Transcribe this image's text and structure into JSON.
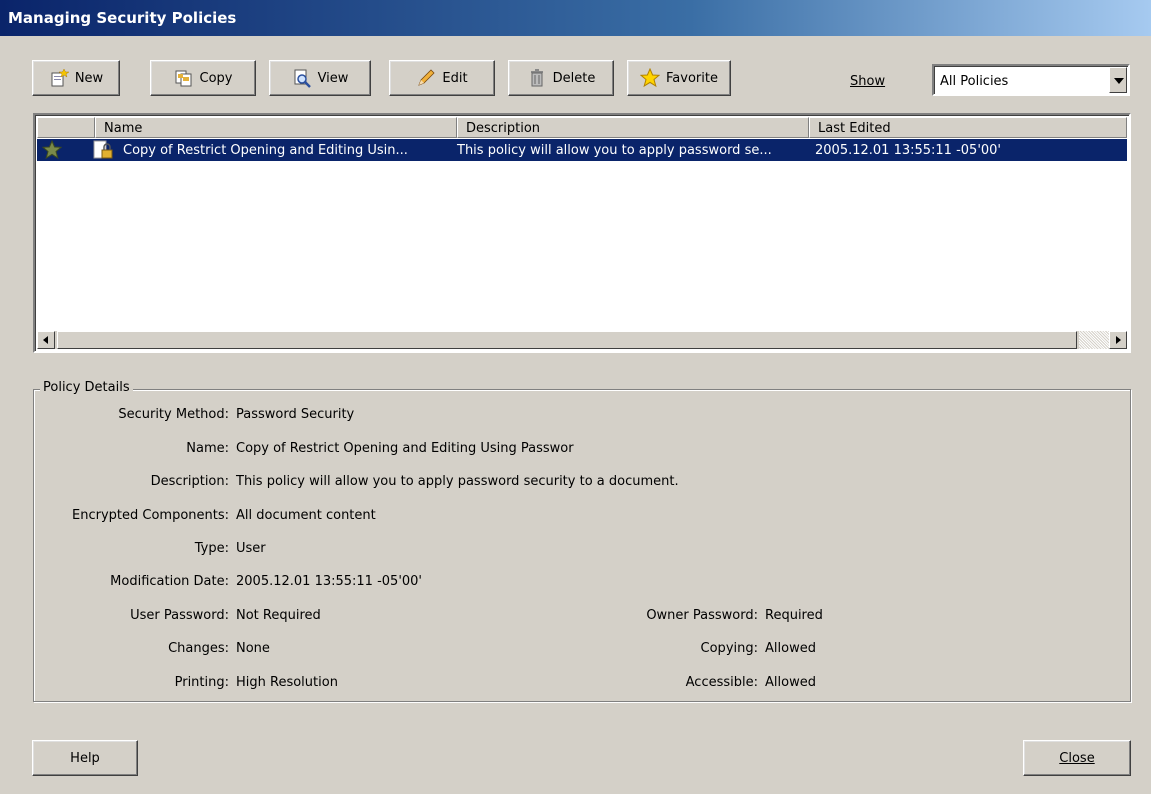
{
  "window": {
    "title": "Managing Security Policies"
  },
  "toolbar": {
    "new_label": "New",
    "copy_label": "Copy",
    "view_label": "View",
    "edit_label": "Edit",
    "delete_label": "Delete",
    "favorite_label": "Favorite",
    "show_label": "Show",
    "show_selected": "All Policies"
  },
  "list": {
    "columns": {
      "name": "Name",
      "description": "Description",
      "last_edited": "Last Edited"
    },
    "rows": [
      {
        "favorite": true,
        "name": "Copy of Restrict Opening and Editing Usin...",
        "description": "This policy will allow you to apply password se...",
        "last_edited": "2005.12.01 13:55:11 -05'00'"
      }
    ]
  },
  "details": {
    "legend": "Policy Details",
    "security_method_label": "Security Method:",
    "security_method": "Password Security",
    "name_label": "Name:",
    "name": "Copy of Restrict Opening and Editing Using Passwor",
    "description_label": "Description:",
    "description": "This policy will allow you to apply password security to a document.",
    "encrypted_label": "Encrypted Components:",
    "encrypted": "All document content",
    "type_label": "Type:",
    "type": "User",
    "modification_label": "Modification Date:",
    "modification": "2005.12.01 13:55:11 -05'00'",
    "user_password_label": "User Password:",
    "user_password": "Not Required",
    "owner_password_label": "Owner Password:",
    "owner_password": "Required",
    "changes_label": "Changes:",
    "changes": "None",
    "copying_label": "Copying:",
    "copying": "Allowed",
    "printing_label": "Printing:",
    "printing": "High Resolution",
    "accessible_label": "Accessible:",
    "accessible": "Allowed"
  },
  "footer": {
    "help_label": "Help",
    "close_label": "Close"
  },
  "colors": {
    "face": "#d4d0c8",
    "selection": "#0a246a",
    "title_start": "#0a246a",
    "title_end": "#a6caf0"
  },
  "icons": [
    "new-policy-icon",
    "copy-policy-icon",
    "view-policy-icon",
    "edit-pencil-icon",
    "delete-trash-icon",
    "favorite-star-icon",
    "star-icon",
    "lock-document-icon"
  ]
}
